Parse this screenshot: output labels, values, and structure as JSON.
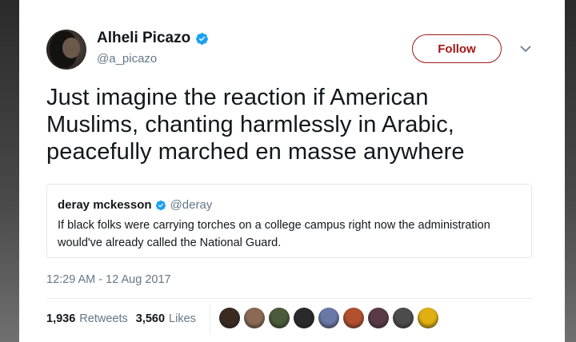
{
  "author": {
    "name": "Alheli Picazo",
    "handle": "@a_picazo",
    "verified": true
  },
  "follow_button": {
    "label": "Follow",
    "color": "#a31616"
  },
  "tweet": {
    "lines": [
      "Just imagine the reaction if American",
      "Muslims, chanting harmlessly in Arabic,",
      "peacefully marched en masse anywhere"
    ]
  },
  "quoted_tweet": {
    "name": "deray mckesson",
    "handle": "@deray",
    "verified": true,
    "lines": [
      "If black folks were carrying torches on a college campus right now the administration",
      "would've already called the National Guard."
    ]
  },
  "timestamp": "12:29 AM - 12 Aug 2017",
  "stats": {
    "retweets_count": "1,936",
    "retweets_label": "Retweets",
    "likes_count": "3,560",
    "likes_label": "Likes"
  },
  "liker_avatars": [
    {
      "name": "liker-avatar-1",
      "color": "#3a2a22"
    },
    {
      "name": "liker-avatar-2",
      "color": "#8a6a55"
    },
    {
      "name": "liker-avatar-3",
      "color": "#4a5a3a"
    },
    {
      "name": "liker-avatar-4",
      "color": "#2a2a2a"
    },
    {
      "name": "liker-avatar-5",
      "color": "#6a78a8"
    },
    {
      "name": "liker-avatar-6",
      "color": "#b2502e"
    },
    {
      "name": "liker-avatar-7",
      "color": "#5a3a48"
    },
    {
      "name": "liker-avatar-8",
      "color": "#4c4c4c"
    },
    {
      "name": "liker-avatar-9",
      "color": "#e0b010"
    }
  ],
  "colors": {
    "verified_blue": "#1da1f2",
    "text_primary": "#14171a",
    "text_secondary": "#657786"
  }
}
